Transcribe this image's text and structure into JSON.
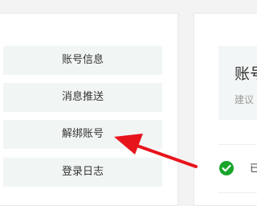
{
  "menu": {
    "items": [
      {
        "label": "账号信息"
      },
      {
        "label": "消息推送"
      },
      {
        "label": "解绑账号"
      },
      {
        "label": "登录日志"
      }
    ]
  },
  "panel": {
    "title": "账号",
    "subtitle": "建议",
    "row_text": "已"
  },
  "annotation": {
    "arrow_color": "#e8141c",
    "icon": "arrow-icon"
  },
  "colors": {
    "menu_bg": "#f1f6f5",
    "check": "#19a52b"
  }
}
